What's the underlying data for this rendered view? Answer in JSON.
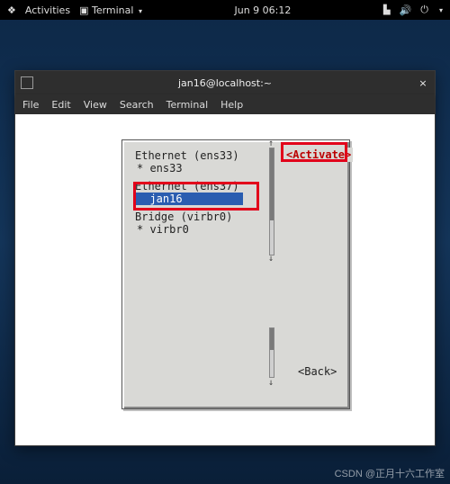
{
  "topbar": {
    "activities": "Activities",
    "app_label": "Terminal",
    "datetime": "Jun 9  06:12"
  },
  "window": {
    "title": "jan16@localhost:~",
    "close_glyph": "×"
  },
  "menu": {
    "file": "File",
    "edit": "Edit",
    "view": "View",
    "search": "Search",
    "terminal": "Terminal",
    "help": "Help"
  },
  "nmtui": {
    "groups": [
      {
        "title": "Ethernet (ens33)",
        "items": [
          "* ens33"
        ]
      },
      {
        "title": "Ethernet (ens37)",
        "items": [
          "  jan16"
        ]
      },
      {
        "title": "Bridge (virbr0)",
        "items": [
          "* virbr0"
        ]
      }
    ],
    "selected_group_index": 1,
    "selected_item_index": 0,
    "activate": "<Activate>",
    "back": "<Back>"
  },
  "watermark": "CSDN @正月十六工作室"
}
